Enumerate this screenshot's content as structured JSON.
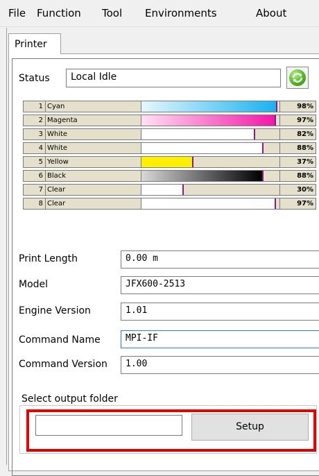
{
  "menu": [
    "File",
    "Function",
    "Tool",
    "Environments",
    "About"
  ],
  "tab_label": "Printer",
  "status": {
    "label": "Status",
    "value": "Local Idle"
  },
  "inks": [
    {
      "num": "1",
      "name": "Cyan",
      "pct": "98%",
      "level": 0.98,
      "color": "cyan"
    },
    {
      "num": "2",
      "name": "Magenta",
      "pct": "97%",
      "level": 0.97,
      "color": "magenta"
    },
    {
      "num": "3",
      "name": "White",
      "pct": "82%",
      "level": 0.82,
      "color": "white"
    },
    {
      "num": "4",
      "name": "White",
      "pct": "88%",
      "level": 0.88,
      "color": "white"
    },
    {
      "num": "5",
      "name": "Yellow",
      "pct": "37%",
      "level": 0.37,
      "color": "yellow"
    },
    {
      "num": "6",
      "name": "Black",
      "pct": "88%",
      "level": 0.88,
      "color": "black"
    },
    {
      "num": "7",
      "name": "Clear",
      "pct": "30%",
      "level": 0.3,
      "color": "clear"
    },
    {
      "num": "8",
      "name": "Clear",
      "pct": "97%",
      "level": 0.97,
      "color": "clear"
    }
  ],
  "fields": [
    {
      "label": "Print Length",
      "value": "0.00 m"
    },
    {
      "label": "Model",
      "value": "JFX600-2513"
    },
    {
      "label": "Engine Version",
      "value": "1.01"
    },
    {
      "label": "Command Name",
      "value": "MPI-IF"
    },
    {
      "label": "Command Version",
      "value": "1.00"
    }
  ],
  "output": {
    "label": "Select output folder",
    "setup_label": "Setup",
    "folder_value": ""
  },
  "colors": {
    "highlight": "#e00000",
    "refresh": "#52b524",
    "ink_row_bg": "#e4e0cc",
    "marker": "#8a1a8a"
  }
}
